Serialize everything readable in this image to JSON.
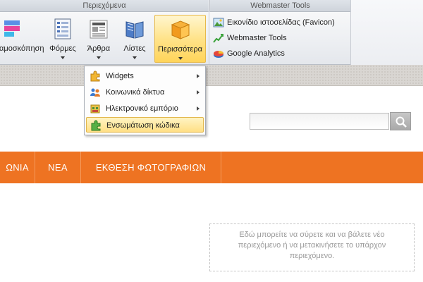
{
  "ribbon": {
    "groups": {
      "content": "Περιεχόμενα",
      "webmaster": "Webmaster Tools"
    },
    "buttons": {
      "preview": "αμοσκόπηση",
      "forms": "Φόρμες",
      "articles": "Άρθρα",
      "lists": "Λίστες",
      "more": "Περισσότερα"
    },
    "webmaster_items": [
      {
        "label": "Εικονίδιο ιστοσελίδας (Favicon)",
        "icon": "favicon-image-icon"
      },
      {
        "label": "Webmaster Tools",
        "icon": "chart-trend-icon"
      },
      {
        "label": "Google Analytics",
        "icon": "analytics-pie-icon"
      }
    ]
  },
  "dropdown": {
    "items": [
      {
        "label": "Widgets",
        "icon": "puzzle-icon",
        "submenu": true
      },
      {
        "label": "Κοινωνικά δίκτυα",
        "icon": "people-icon",
        "submenu": true
      },
      {
        "label": "Ηλεκτρονικό εμπόριο",
        "icon": "shop-icon",
        "submenu": true
      },
      {
        "label": "Ενσωμάτωση κώδικα",
        "icon": "embed-code-icon",
        "submenu": false,
        "highlighted": true
      }
    ]
  },
  "page": {
    "search": {
      "placeholder": "",
      "value": ""
    },
    "nav": [
      "ΩΝΙΑ",
      "ΝΕΑ",
      "ΕΚΘΕΣΗ ΦΩΤΟΓΡΑΦΙΩΝ"
    ],
    "drop_zone_text": "Εδώ μπορείτε να σύρετε και να βάλετε νέο περιεχόμενο ή να μετακινήσετε το υπάρχον περιεχόμενο."
  },
  "colors": {
    "nav": "#ee7322",
    "highlight": "#ffdf85"
  }
}
